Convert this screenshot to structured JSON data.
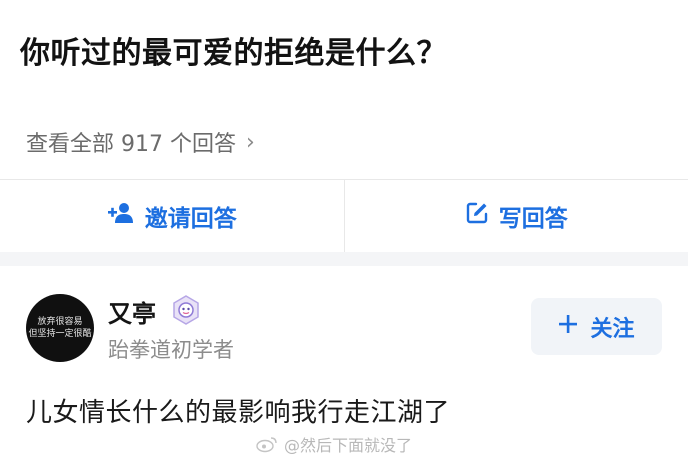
{
  "question": {
    "title": "你听过的最可爱的拒绝是什么？"
  },
  "answers_link": {
    "label": "查看全部 917 个回答",
    "chevron": "›"
  },
  "actions": {
    "invite": {
      "icon": "add-person-icon",
      "label": "邀请回答"
    },
    "write": {
      "icon": "edit-icon",
      "label": "写回答"
    }
  },
  "author": {
    "avatar_line1": "放弃很容易",
    "avatar_line2": "但坚持一定很酷",
    "name": "又亭",
    "badge_icon": "creator-badge-icon",
    "bio": "跆拳道初学者"
  },
  "follow": {
    "icon": "plus-icon",
    "label": "关注"
  },
  "answer": {
    "excerpt": "儿女情长什么的最影响我行走江湖了"
  },
  "watermark": {
    "text": "@然后下面就没了"
  },
  "colors": {
    "accent": "#1d6fe0",
    "muted": "#8c8c8c"
  }
}
